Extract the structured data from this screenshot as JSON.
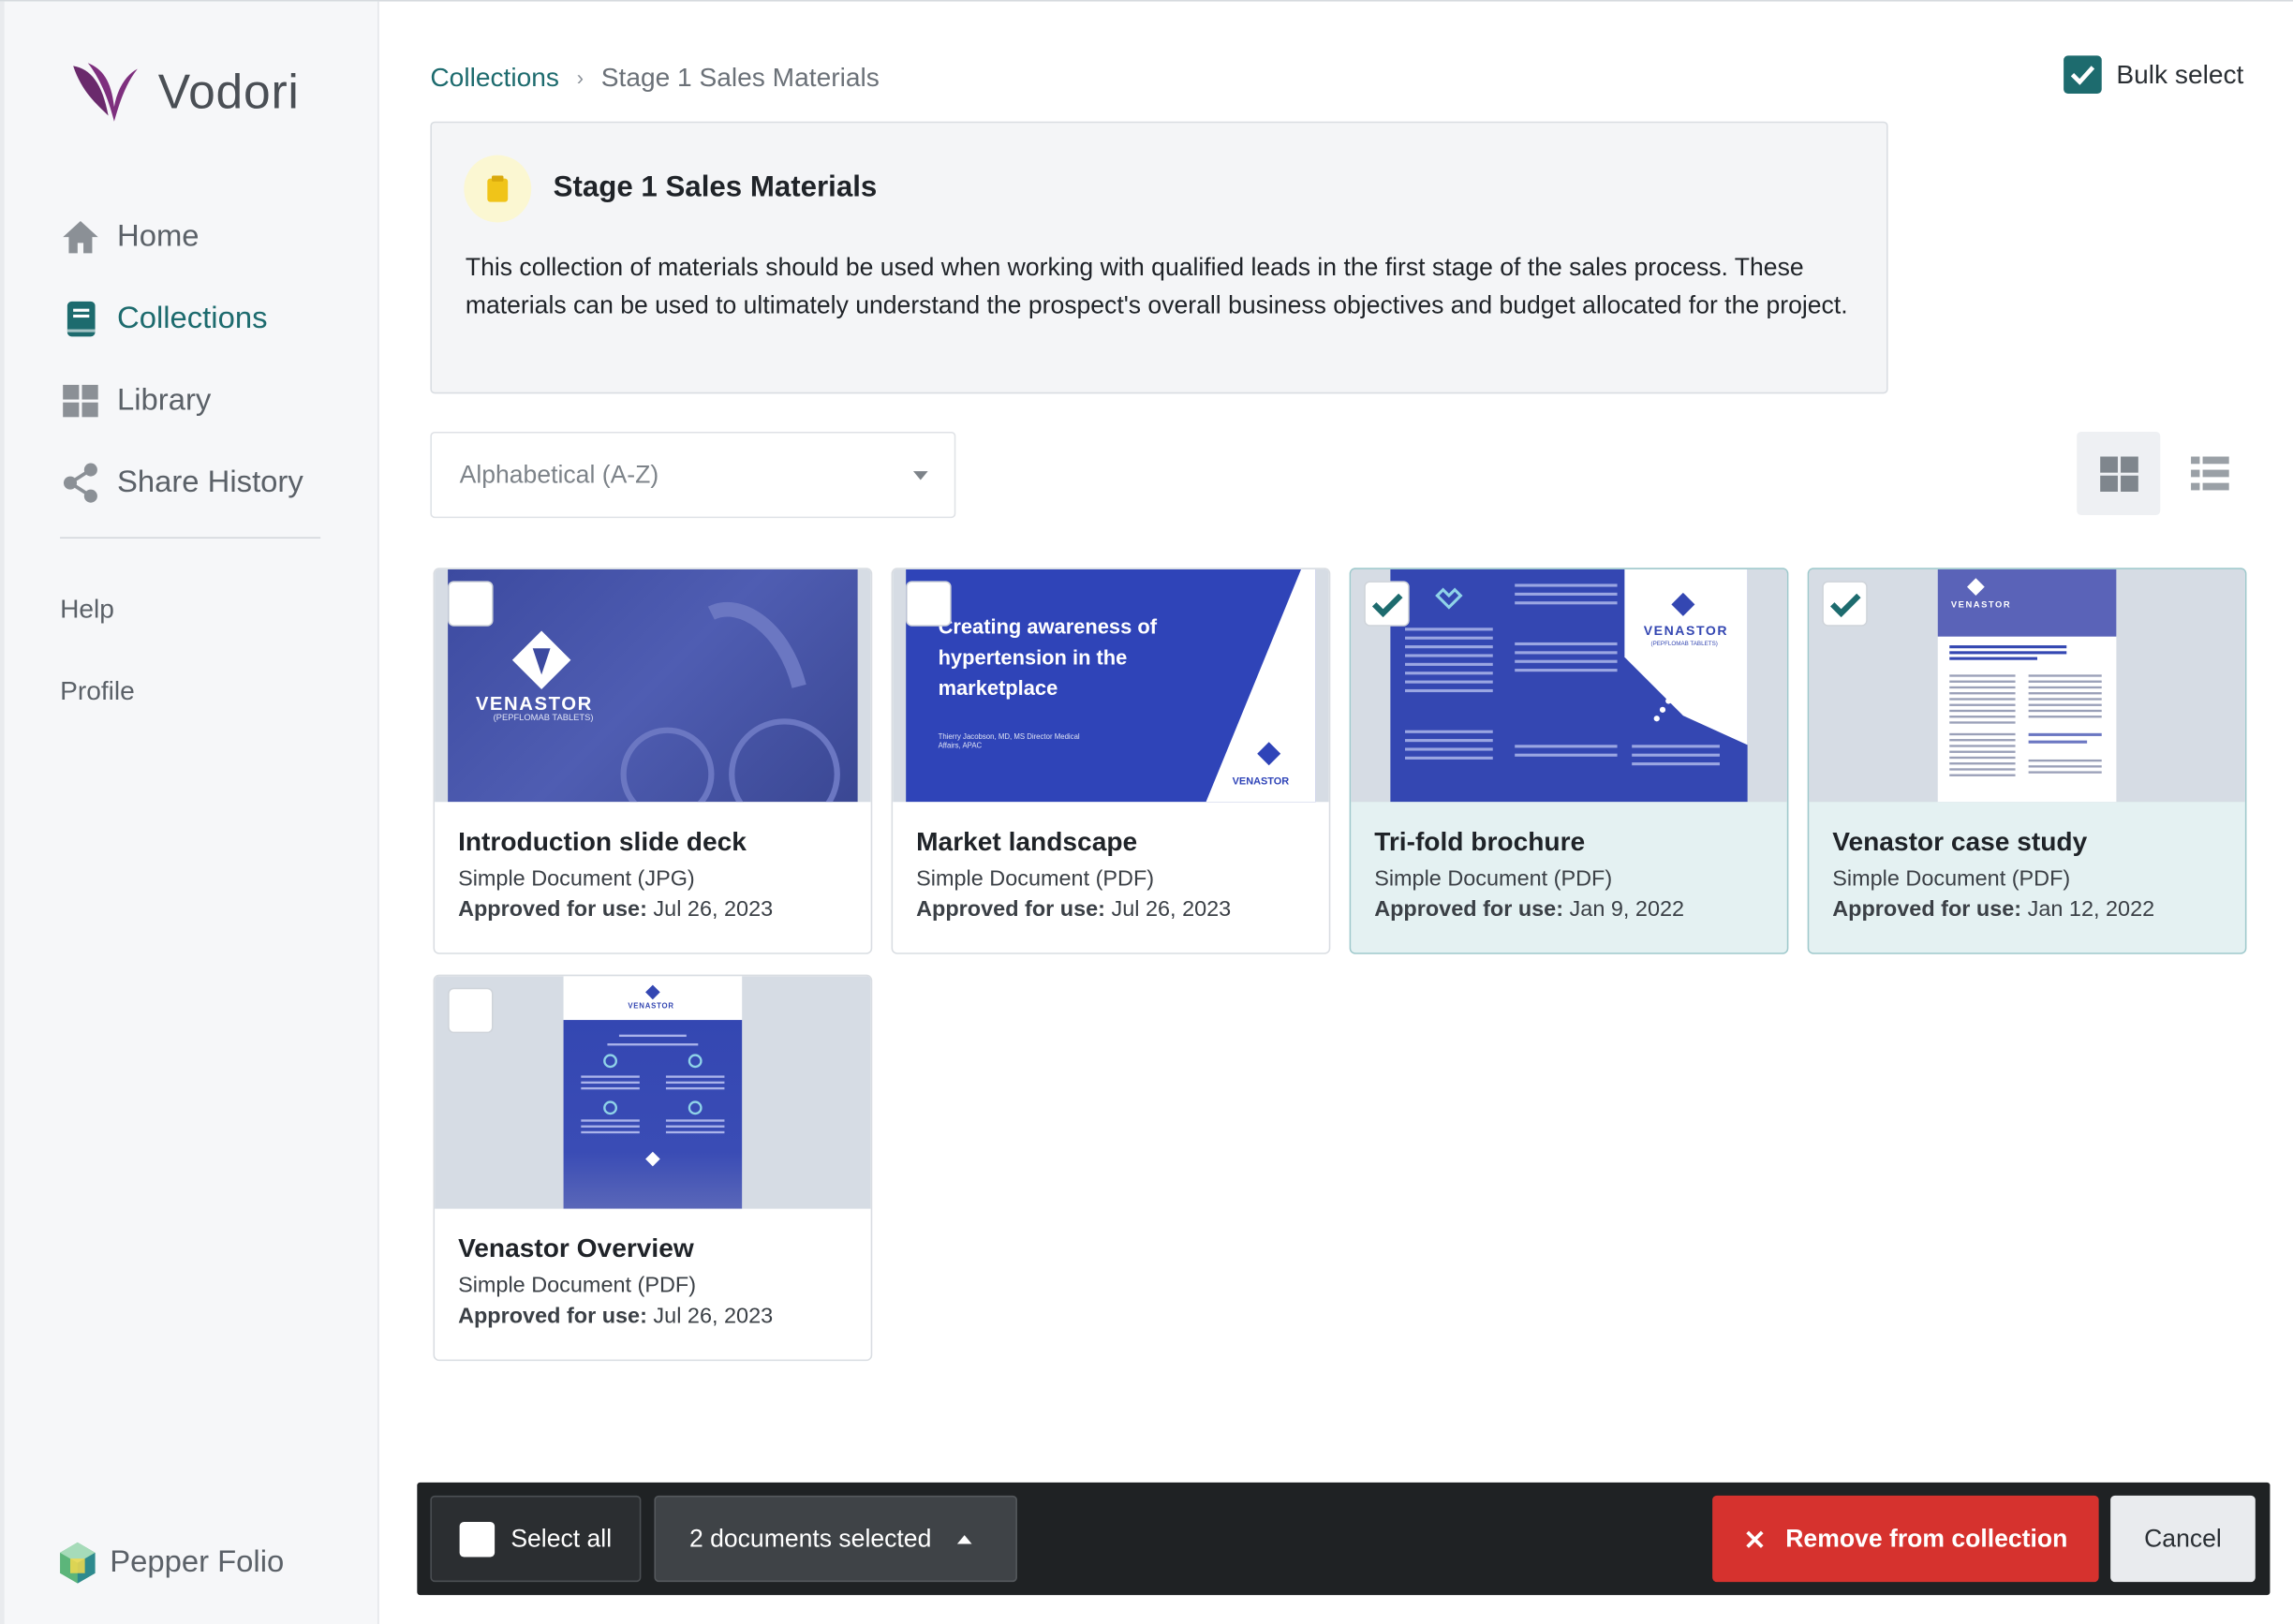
{
  "app": {
    "brand": "Vodori",
    "footer_brand": "Pepper Folio"
  },
  "sidebar": {
    "items": [
      {
        "label": "Home",
        "icon": "home-icon"
      },
      {
        "label": "Collections",
        "icon": "book-icon",
        "active": true
      },
      {
        "label": "Library",
        "icon": "grid-icon"
      },
      {
        "label": "Share History",
        "icon": "share-icon"
      }
    ],
    "secondary": [
      {
        "label": "Help"
      },
      {
        "label": "Profile"
      }
    ]
  },
  "breadcrumb": {
    "parent": "Collections",
    "current": "Stage 1 Sales Materials"
  },
  "bulk_select": {
    "label": "Bulk select",
    "checked": true
  },
  "collection": {
    "title": "Stage 1 Sales Materials",
    "description": "This collection of materials should be used when working with qualified leads in the first stage of the sales process. These materials can be used to ultimately understand the prospect's overall business objectives and budget allocated for the project."
  },
  "sort": {
    "selected": "Alphabetical (A-Z)"
  },
  "view_modes": {
    "active": "grid"
  },
  "approved_label": "Approved for use:",
  "documents": [
    {
      "name": "Introduction slide deck",
      "type": "Simple Document (JPG)",
      "approved": "Jul 26, 2023",
      "selected": false,
      "thumb_text": "VENASTOR",
      "thumb_sub": "(PEPFLOMAB TABLETS)"
    },
    {
      "name": "Market landscape",
      "type": "Simple Document (PDF)",
      "approved": "Jul 26, 2023",
      "selected": false,
      "thumb_text": "Creating awareness of hypertension in the marketplace",
      "thumb_sub": "Thierry Jacobson, MD, MS  Director Medical Affairs, APAC",
      "thumb_brand": "VENASTOR"
    },
    {
      "name": "Tri-fold brochure",
      "type": "Simple Document (PDF)",
      "approved": "Jan 9, 2022",
      "selected": true,
      "thumb_text": "VENASTOR",
      "thumb_sub": "(PEPFLOMAB TABLETS)"
    },
    {
      "name": "Venastor case study",
      "type": "Simple Document (PDF)",
      "approved": "Jan 12, 2022",
      "selected": true,
      "thumb_text": "VENASTOR"
    },
    {
      "name": "Venastor Overview",
      "type": "Simple Document (PDF)",
      "approved": "Jul 26, 2023",
      "selected": false,
      "thumb_text": "VENASTOR"
    }
  ],
  "bottom_bar": {
    "select_all": "Select all",
    "selected_count": "2 documents selected",
    "remove": "Remove from collection",
    "cancel": "Cancel"
  },
  "colors": {
    "accent": "#1d6b6e",
    "danger": "#d6322e",
    "selected_card": "#e4f1f2",
    "thumb_blue": "#2f44b8"
  }
}
